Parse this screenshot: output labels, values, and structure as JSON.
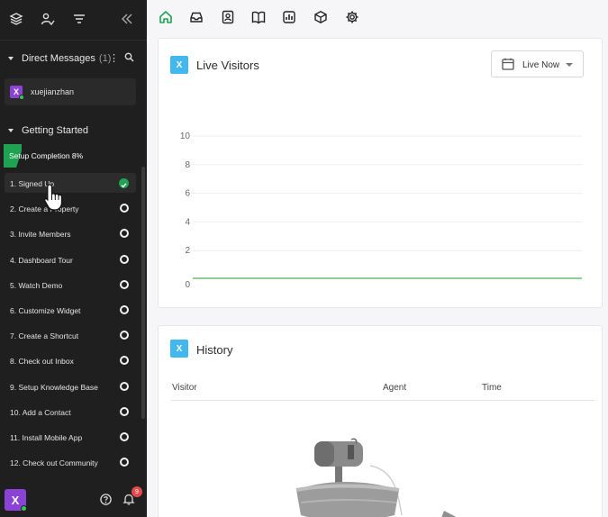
{
  "sidebar": {
    "top_icons": [
      "layers-icon",
      "user-check-icon",
      "filter-icon",
      "collapse-icon"
    ],
    "direct_messages": {
      "title": "Direct Messages",
      "count": "(1)"
    },
    "dm_users": [
      {
        "initial": "X",
        "name": "xuejianzhan"
      }
    ],
    "getting_started": {
      "title": "Getting Started"
    },
    "setup_completion": "Setup Completion 8%",
    "steps": [
      {
        "label": "1. Signed Up",
        "done": true
      },
      {
        "label": "2. Create a Property",
        "done": false
      },
      {
        "label": "3. Invite Members",
        "done": false
      },
      {
        "label": "4. Dashboard Tour",
        "done": false
      },
      {
        "label": "5. Watch Demo",
        "done": false
      },
      {
        "label": "6. Customize Widget",
        "done": false
      },
      {
        "label": "7. Create a Shortcut",
        "done": false
      },
      {
        "label": "8. Check out Inbox",
        "done": false
      },
      {
        "label": "9. Setup Knowledge Base",
        "done": false
      },
      {
        "label": "10. Add a Contact",
        "done": false
      },
      {
        "label": "11. Install Mobile App",
        "done": false
      },
      {
        "label": "12. Check out Community",
        "done": false
      }
    ],
    "footer": {
      "avatar_initial": "X",
      "notification_count": "9"
    }
  },
  "topnav": {
    "icons": [
      "home-icon",
      "inbox-icon",
      "contacts-icon",
      "knowledge-base-icon",
      "reports-icon",
      "apps-icon",
      "settings-icon"
    ]
  },
  "live_visitors": {
    "badge": "X",
    "title": "Live Visitors",
    "range_label": "Live Now"
  },
  "chart_data": {
    "type": "line",
    "y_ticks": [
      0,
      2,
      4,
      6,
      8,
      10
    ],
    "ylim": [
      0,
      10
    ],
    "series": [
      {
        "values": [
          0,
          0
        ]
      }
    ],
    "grid": true,
    "line_color": "#4caf50"
  },
  "history": {
    "badge": "X",
    "title": "History",
    "columns": [
      "Visitor",
      "Agent",
      "Time"
    ]
  },
  "colors": {
    "accent_green": "#1fa352",
    "avatar_purple": "#8b43d6",
    "badge_blue": "#43b8ee"
  }
}
